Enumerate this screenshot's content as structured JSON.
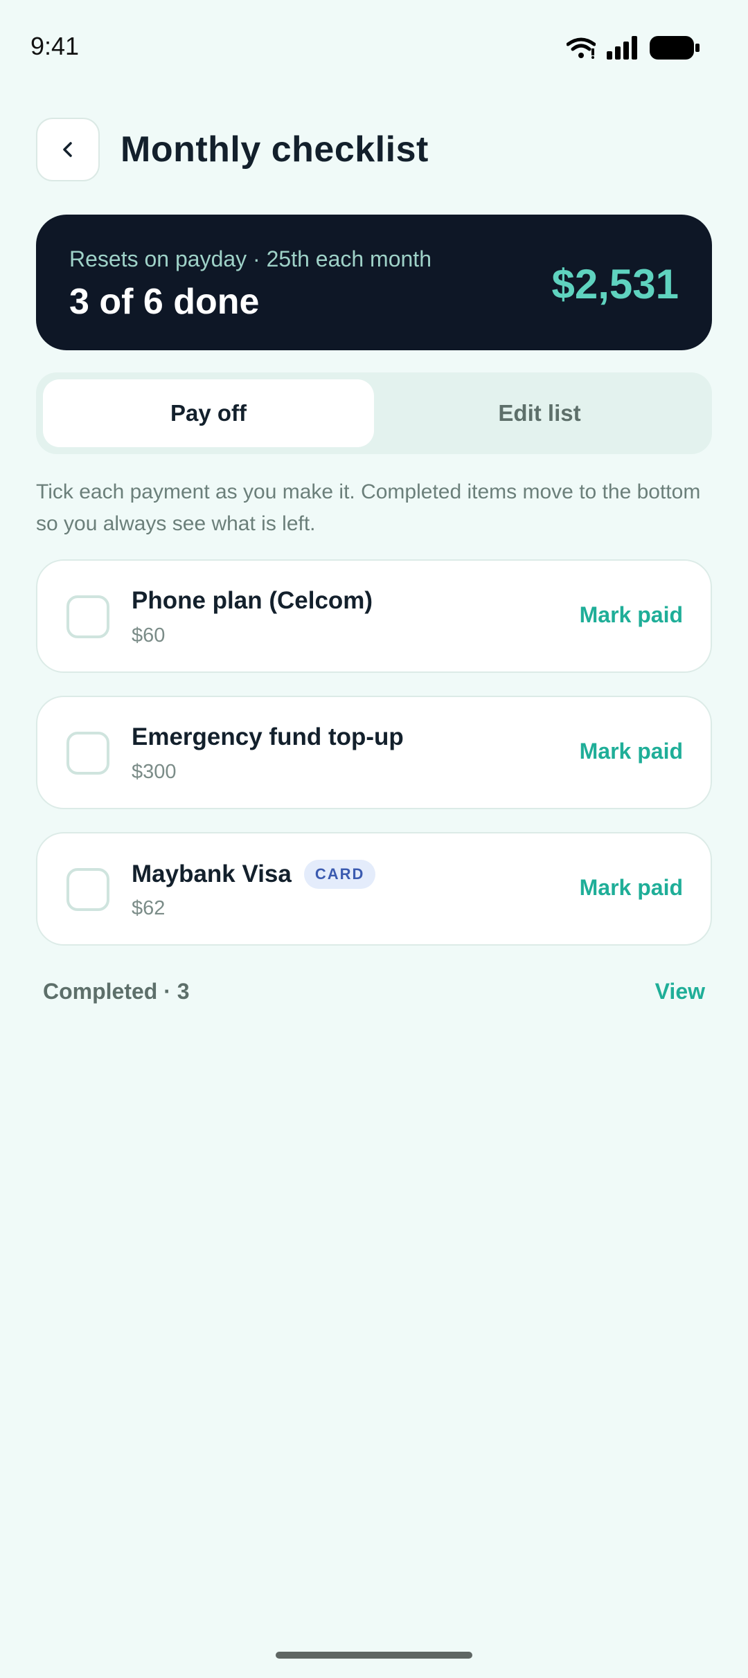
{
  "status_bar": {
    "time": "9:41"
  },
  "header": {
    "title": "Monthly checklist"
  },
  "summary": {
    "subtitle": "Resets on payday · 25th each month",
    "progress_text": "3 of 6 done",
    "amount": "$2,531"
  },
  "tabs": [
    {
      "label": "Pay off",
      "active": true
    },
    {
      "label": "Edit list",
      "active": false
    }
  ],
  "helper_text": "Tick each payment as you make it. Completed items move to the bottom so you always see what is left.",
  "items": [
    {
      "name": "Phone plan (Celcom)",
      "amount": "$60",
      "badge": "",
      "action": "Mark paid"
    },
    {
      "name": "Emergency fund top-up",
      "amount": "$300",
      "badge": "",
      "action": "Mark paid"
    },
    {
      "name": "Maybank Visa",
      "amount": "$62",
      "badge": "CARD",
      "action": "Mark paid"
    }
  ],
  "completed": {
    "label": "Completed · 3",
    "link": "View"
  },
  "colors": {
    "accent": "#1fae98",
    "summary_bg": "#0e1726",
    "page_bg": "#f0faf8"
  }
}
